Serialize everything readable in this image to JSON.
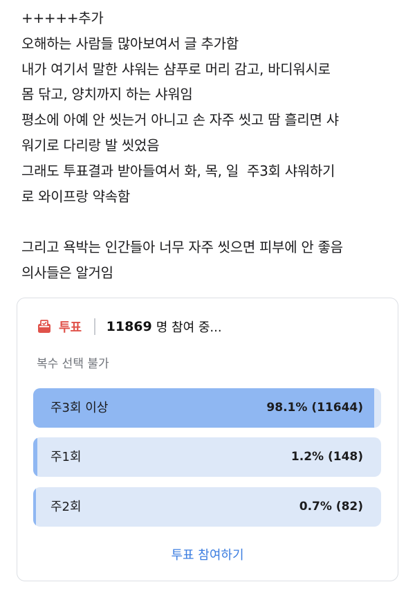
{
  "post": {
    "lines": [
      "+++++추가",
      "오해하는 사람들 많아보여서 글 추가함",
      "내가 여기서 말한 샤워는 샴푸로 머리 감고, 바디워시로",
      "몸 닦고, 양치까지 하는 샤워임",
      "평소에 아예 안 씻는거 아니고 손 자주 씻고 땀 흘리면 샤",
      "워기로 다리랑 발 씻었음",
      "그래도 투표결과 받아들여서 화, 목, 일  주3회 샤워하기",
      "로 와이프랑 약속함",
      "",
      "그리고 욕박는 인간들아 너무 자주 씻으면 피부에 안 좋음",
      "의사들은 알거임"
    ]
  },
  "poll": {
    "icon": "ballot-box-icon",
    "tag": "투표",
    "count": "11869",
    "count_suffix": "명 참여 중...",
    "note": "복수 선택 불가",
    "accent_color": "#e0524a",
    "fill_color": "#8fb7f2",
    "track_color": "#dde8f8",
    "options": [
      {
        "label": "주3회 이상",
        "stat": "98.1% (11644)",
        "percent": 98.1
      },
      {
        "label": "주1회",
        "stat": "1.2% (148)",
        "percent": 1.2
      },
      {
        "label": "주2회",
        "stat": "0.7% (82)",
        "percent": 0.7
      }
    ],
    "join_label": "투표 참여하기"
  }
}
